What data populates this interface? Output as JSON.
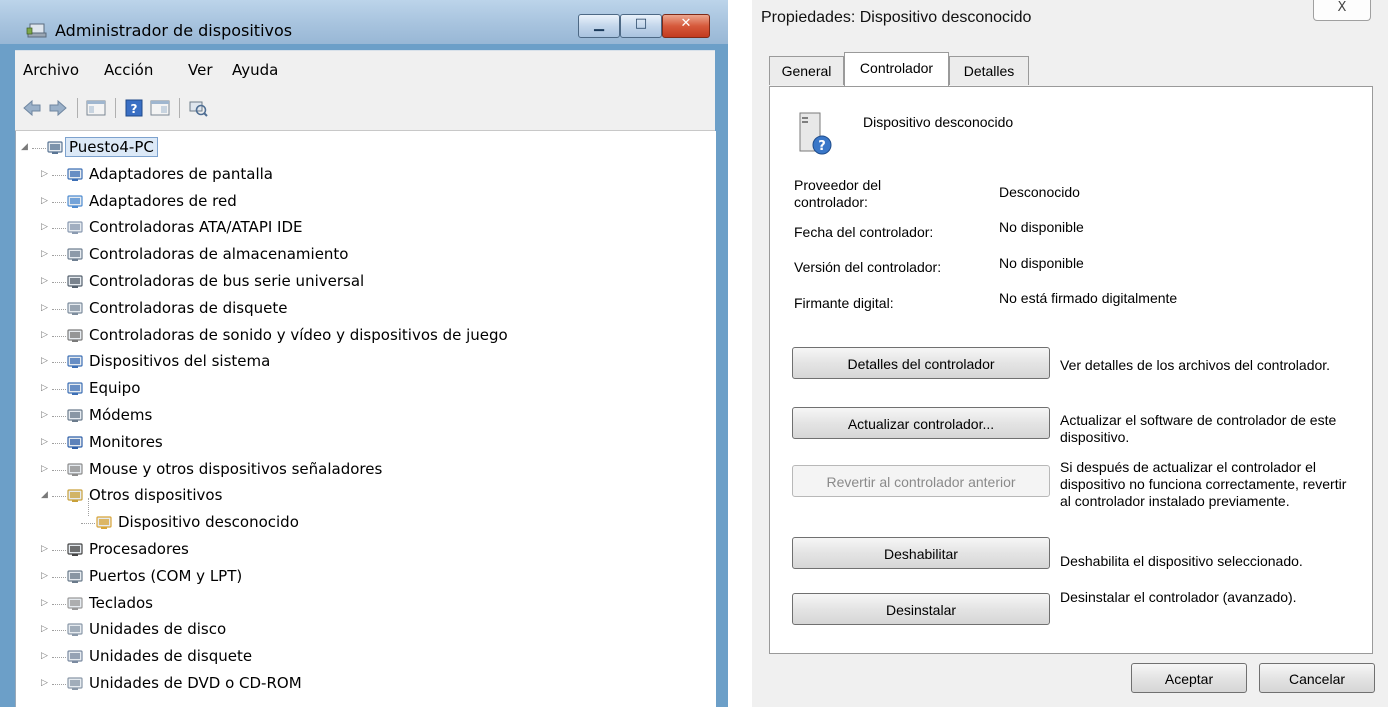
{
  "device_manager": {
    "title": "Administrador de dispositivos",
    "menu": [
      "Archivo",
      "Acción",
      "Ver",
      "Ayuda"
    ],
    "toolbar_icons": [
      "back-arrow-icon",
      "forward-arrow-icon",
      "properties-icon",
      "help-icon",
      "console-tree-icon",
      "scan-hardware-icon"
    ],
    "tree": {
      "root": "Puesto4-PC",
      "categories": [
        {
          "label": "Adaptadores de pantalla",
          "icon": "display-adapter-icon"
        },
        {
          "label": "Adaptadores de red",
          "icon": "network-adapter-icon"
        },
        {
          "label": "Controladoras ATA/ATAPI IDE",
          "icon": "ide-controller-icon"
        },
        {
          "label": "Controladoras de almacenamiento",
          "icon": "storage-controller-icon"
        },
        {
          "label": "Controladoras de bus serie universal",
          "icon": "usb-controller-icon"
        },
        {
          "label": "Controladoras de disquete",
          "icon": "floppy-controller-icon"
        },
        {
          "label": "Controladoras de sonido y vídeo y dispositivos de juego",
          "icon": "sound-icon"
        },
        {
          "label": "Dispositivos del sistema",
          "icon": "system-devices-icon"
        },
        {
          "label": "Equipo",
          "icon": "computer-icon"
        },
        {
          "label": "Módems",
          "icon": "modem-icon"
        },
        {
          "label": "Monitores",
          "icon": "monitor-icon"
        },
        {
          "label": "Mouse y otros dispositivos señaladores",
          "icon": "mouse-icon"
        },
        {
          "label": "Otros dispositivos",
          "icon": "other-devices-icon"
        },
        {
          "label": "Procesadores",
          "icon": "processor-icon"
        },
        {
          "label": "Puertos (COM y LPT)",
          "icon": "ports-icon"
        },
        {
          "label": "Teclados",
          "icon": "keyboard-icon"
        },
        {
          "label": "Unidades de disco",
          "icon": "disk-drive-icon"
        },
        {
          "label": "Unidades de disquete",
          "icon": "floppy-drive-icon"
        },
        {
          "label": "Unidades de DVD o CD-ROM",
          "icon": "dvd-drive-icon"
        }
      ],
      "unknown_device": "Dispositivo desconocido"
    }
  },
  "properties": {
    "title": "Propiedades: Dispositivo desconocido",
    "close_glyph": "X",
    "tabs": [
      "General",
      "Controlador",
      "Detalles"
    ],
    "active_tab": "Controlador",
    "device_name": "Dispositivo desconocido",
    "fields": [
      {
        "label": "Proveedor del controlador:",
        "value": "Desconocido"
      },
      {
        "label": "Fecha del controlador:",
        "value": "No disponible"
      },
      {
        "label": "Versión del controlador:",
        "value": "No disponible"
      },
      {
        "label": "Firmante digital:",
        "value": "No está firmado digitalmente"
      }
    ],
    "actions": [
      {
        "button": "Detalles del controlador",
        "description": "Ver detalles de los archivos del controlador.",
        "enabled": true
      },
      {
        "button": "Actualizar controlador...",
        "description": "Actualizar el software de controlador de este dispositivo.",
        "enabled": true
      },
      {
        "button": "Revertir al controlador anterior",
        "description": "Si después de actualizar el controlador el dispositivo no funciona correctamente, revertir al controlador instalado previamente.",
        "enabled": false
      },
      {
        "button": "Deshabilitar",
        "description": "Deshabilita el dispositivo seleccionado.",
        "enabled": true
      },
      {
        "button": "Desinstalar",
        "description": "Desinstalar el controlador (avanzado).",
        "enabled": true
      }
    ],
    "ok_label": "Aceptar",
    "cancel_label": "Cancelar"
  }
}
